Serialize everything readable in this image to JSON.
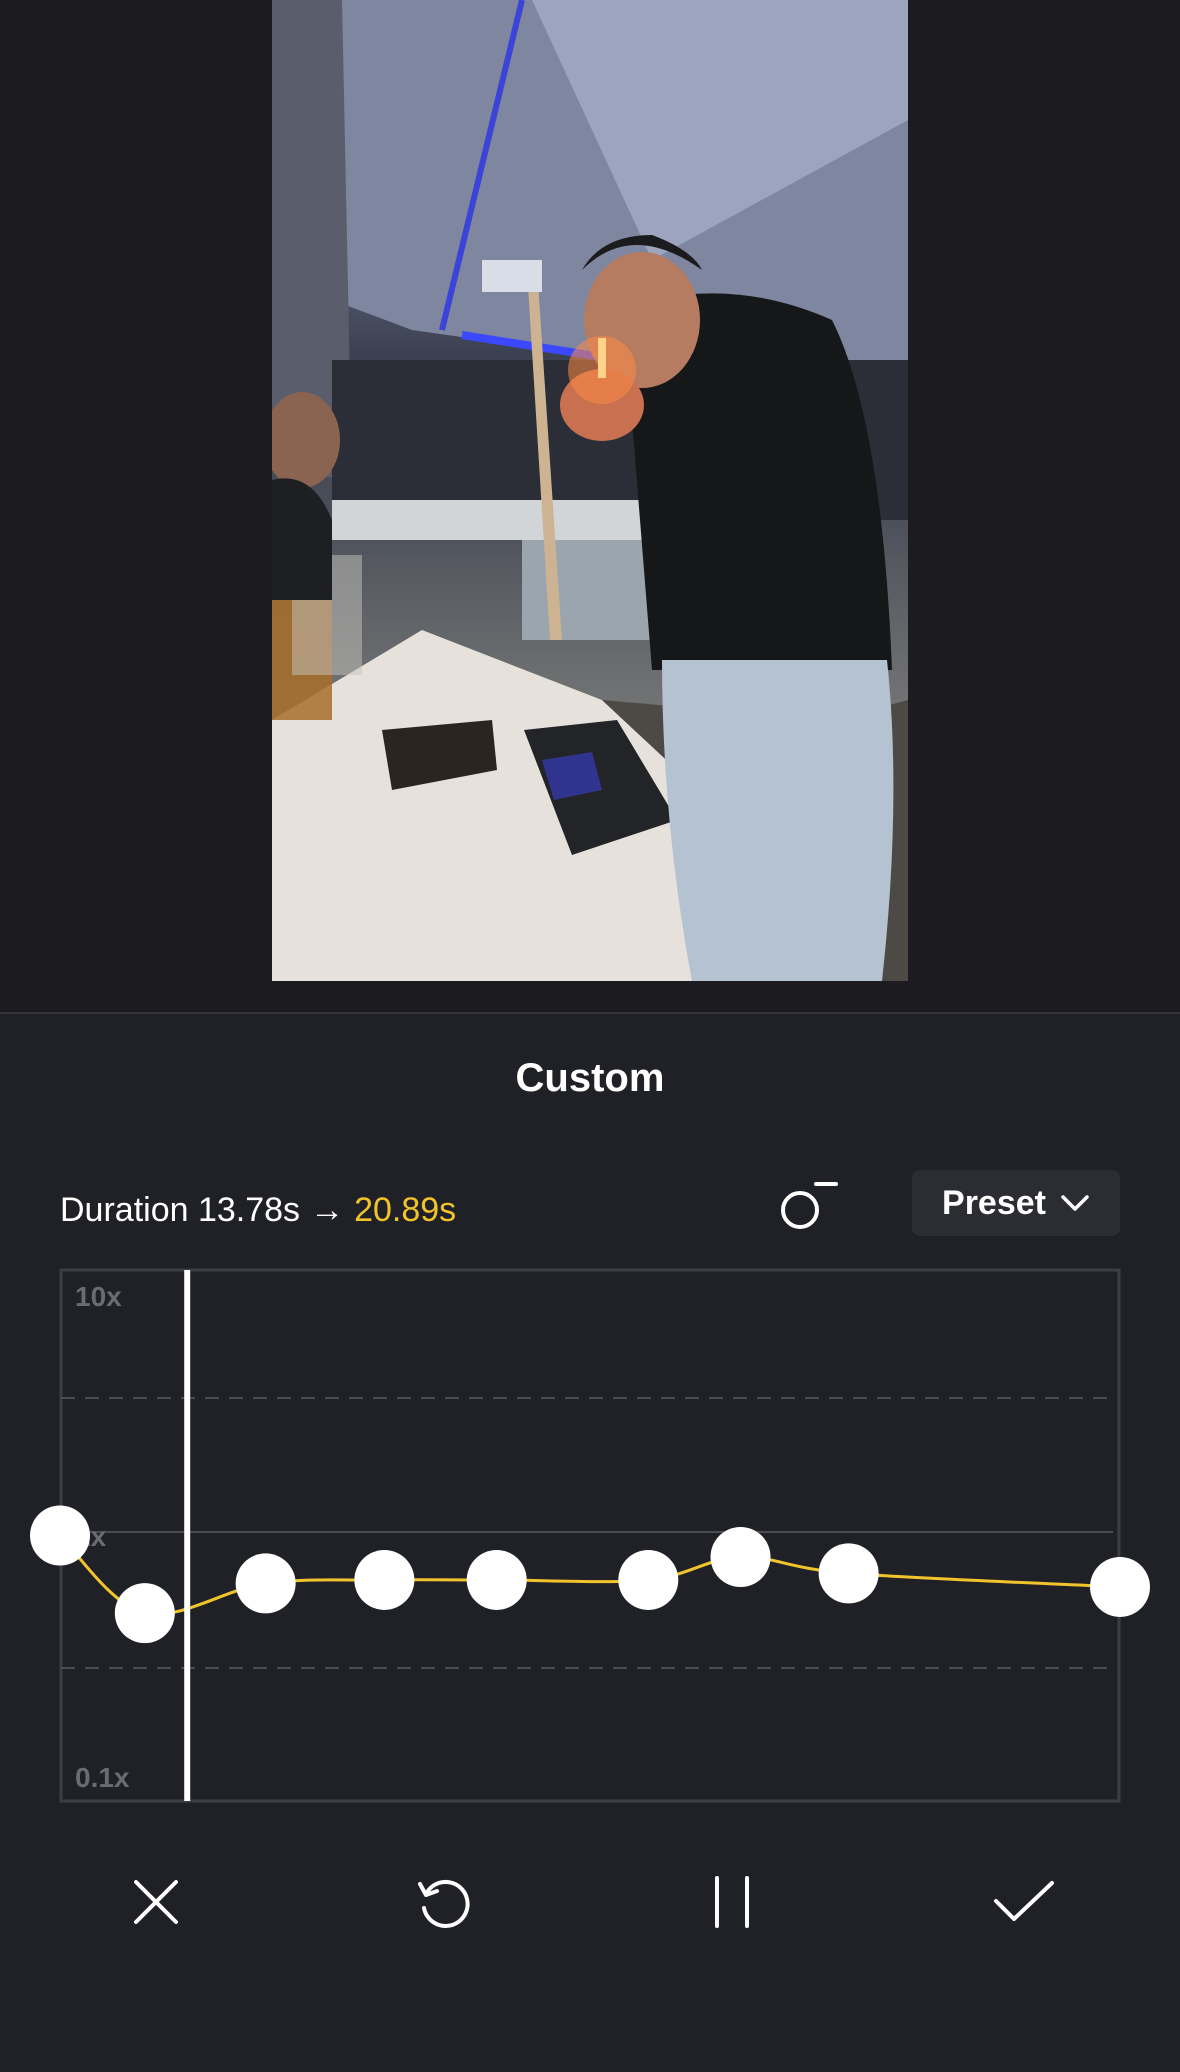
{
  "panel": {
    "title": "Custom"
  },
  "duration": {
    "label": "Duration",
    "original": "13.78s",
    "arrow": "→",
    "new": "20.89s"
  },
  "preset": {
    "label": "Preset"
  },
  "speed_graph": {
    "max_label": "10x",
    "mid_label": "1x",
    "min_label": "0.1x",
    "playhead_position": 0.12,
    "points": [
      {
        "time": 0.0,
        "speed": 1.0
      },
      {
        "time": 0.08,
        "speed": 0.51
      },
      {
        "time": 0.194,
        "speed": 0.66
      },
      {
        "time": 0.306,
        "speed": 0.68
      },
      {
        "time": 0.412,
        "speed": 0.68
      },
      {
        "time": 0.555,
        "speed": 0.68
      },
      {
        "time": 0.642,
        "speed": 0.83
      },
      {
        "time": 0.744,
        "speed": 0.72
      },
      {
        "time": 1.0,
        "speed": 0.64
      }
    ],
    "curve_color": "#f2c42c"
  },
  "toolbar": {
    "cancel_icon": "close-icon",
    "reset_icon": "reset-icon",
    "pause_icon": "pause-icon",
    "confirm_icon": "check-icon"
  }
}
